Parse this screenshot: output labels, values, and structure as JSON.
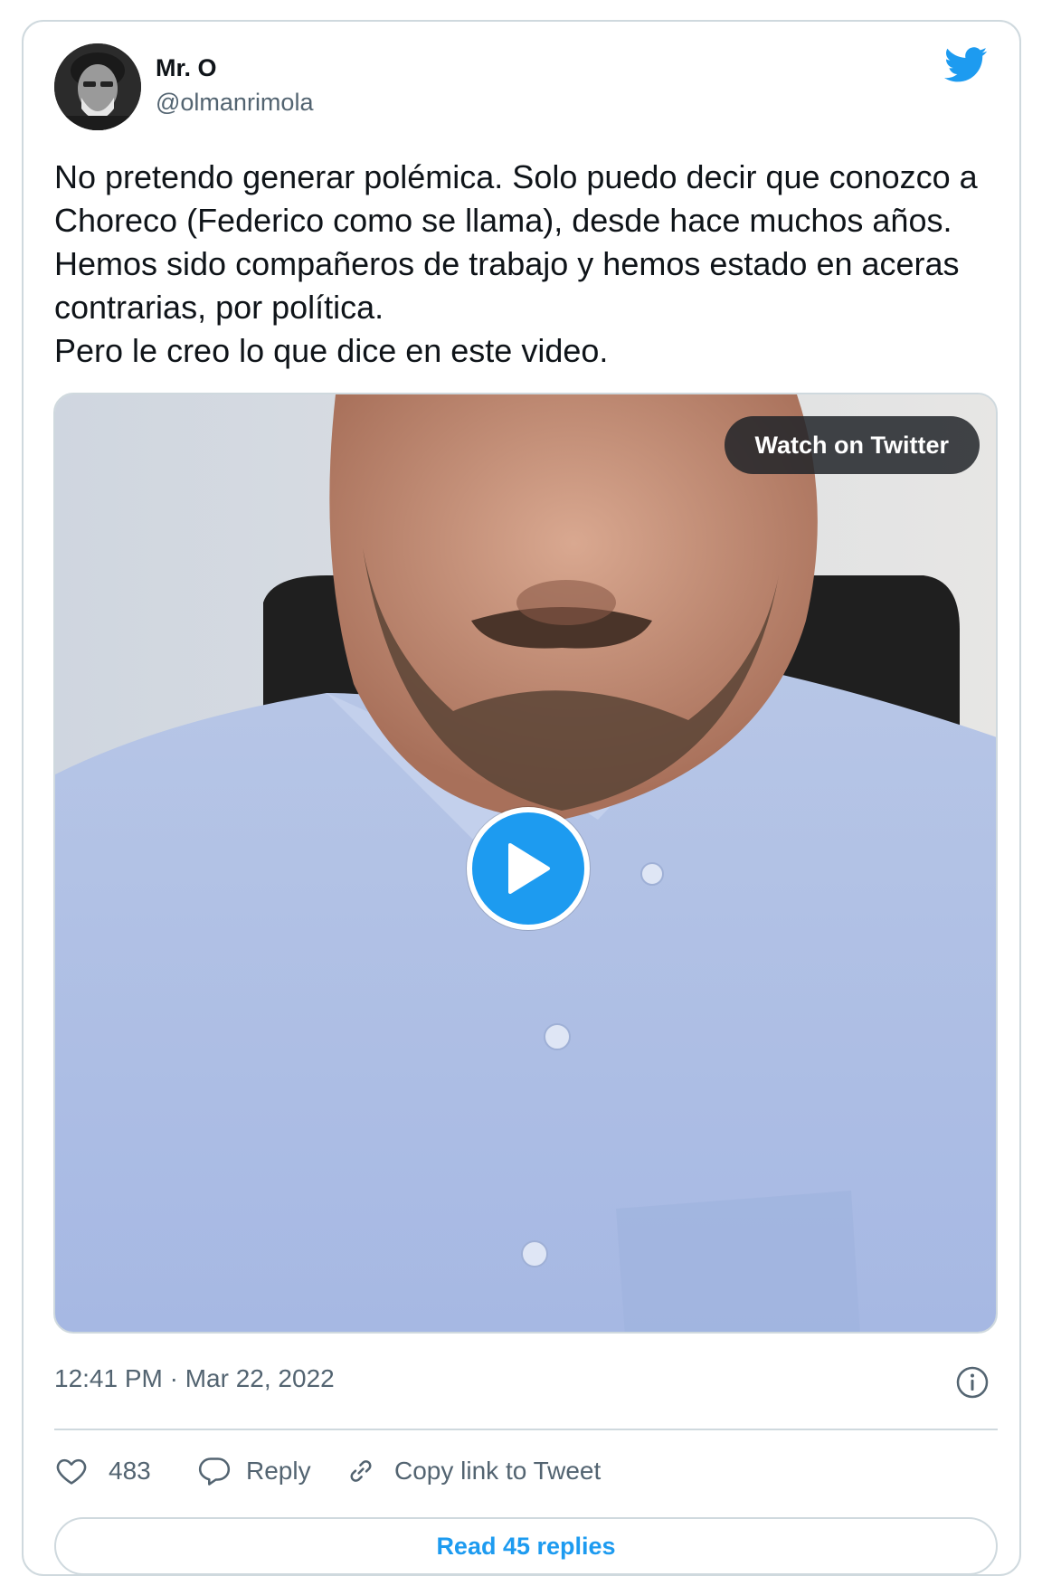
{
  "author": {
    "name": "Mr. O",
    "handle": "@olmanrimola"
  },
  "tweet": {
    "text": "No pretendo generar polémica. Solo puedo decir que conozco a Choreco (Federico como se llama), desde hace muchos años. Hemos sido compañeros de trabajo y hemos estado en aceras contrarias, por política.\nPero le creo lo que dice en este video.",
    "timestamp": "12:41 PM · Mar 22, 2022"
  },
  "media": {
    "watch_label": "Watch on Twitter"
  },
  "actions": {
    "like_count": "483",
    "reply_label": "Reply",
    "copy_label": "Copy link to Tweet"
  },
  "footer": {
    "read_replies_label": "Read 45 replies"
  },
  "colors": {
    "brand": "#1d9bf0",
    "text_primary": "#0f1419",
    "text_secondary": "#536471",
    "border": "#cfd9de"
  }
}
